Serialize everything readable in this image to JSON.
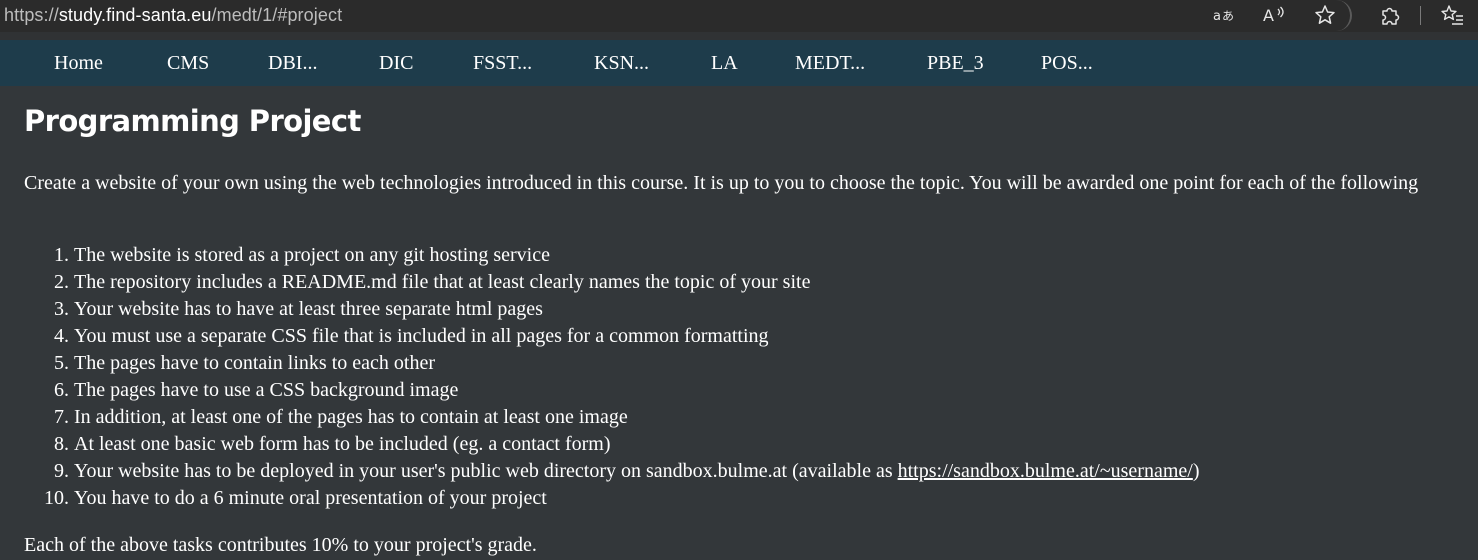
{
  "browser": {
    "url_scheme": "https://",
    "url_host": "study.find-santa.eu",
    "url_path": "/medt/1/#project",
    "icons": [
      "translate-icon",
      "read-aloud-icon",
      "favorite-star-icon",
      "extensions-icon",
      "favorites-list-icon"
    ]
  },
  "nav": {
    "items": [
      {
        "label": "Home"
      },
      {
        "label": "CMS"
      },
      {
        "label": "DBI..."
      },
      {
        "label": "DIC"
      },
      {
        "label": "FSST..."
      },
      {
        "label": "KSN..."
      },
      {
        "label": "LA"
      },
      {
        "label": "MEDT..."
      },
      {
        "label": "PBE_3"
      },
      {
        "label": "POS..."
      }
    ]
  },
  "main": {
    "title": "Programming Project",
    "intro": "Create a website of your own using the web technologies introduced in this course. It is up to you to choose the topic. You will be awarded one point for each of the following",
    "requirements": [
      "The website is stored as a project on any git hosting service",
      "The repository includes a README.md file that at least clearly names the topic of your site",
      "Your website has to have at least three separate html pages",
      "You must use a separate CSS file that is included in all pages for a common formatting",
      "The pages have to contain links to each other",
      "The pages have to use a CSS background image",
      "In addition, at least one of the pages has to contain at least one image",
      "At least one basic web form has to be included (eg. a contact form)",
      "Your website has to be deployed in your user's public web directory on sandbox.bulme.at (available as ",
      "You have to do a 6 minute oral presentation of your project"
    ],
    "requirement9_link": "https://sandbox.bulme.at/~username/",
    "requirement9_suffix": ")",
    "outro": "Each of the above tasks contributes 10% to your project's grade."
  },
  "colors": {
    "nav_background": "#1e3c4b",
    "page_background": "#33373a",
    "browser_bar": "#2b2b2b"
  }
}
